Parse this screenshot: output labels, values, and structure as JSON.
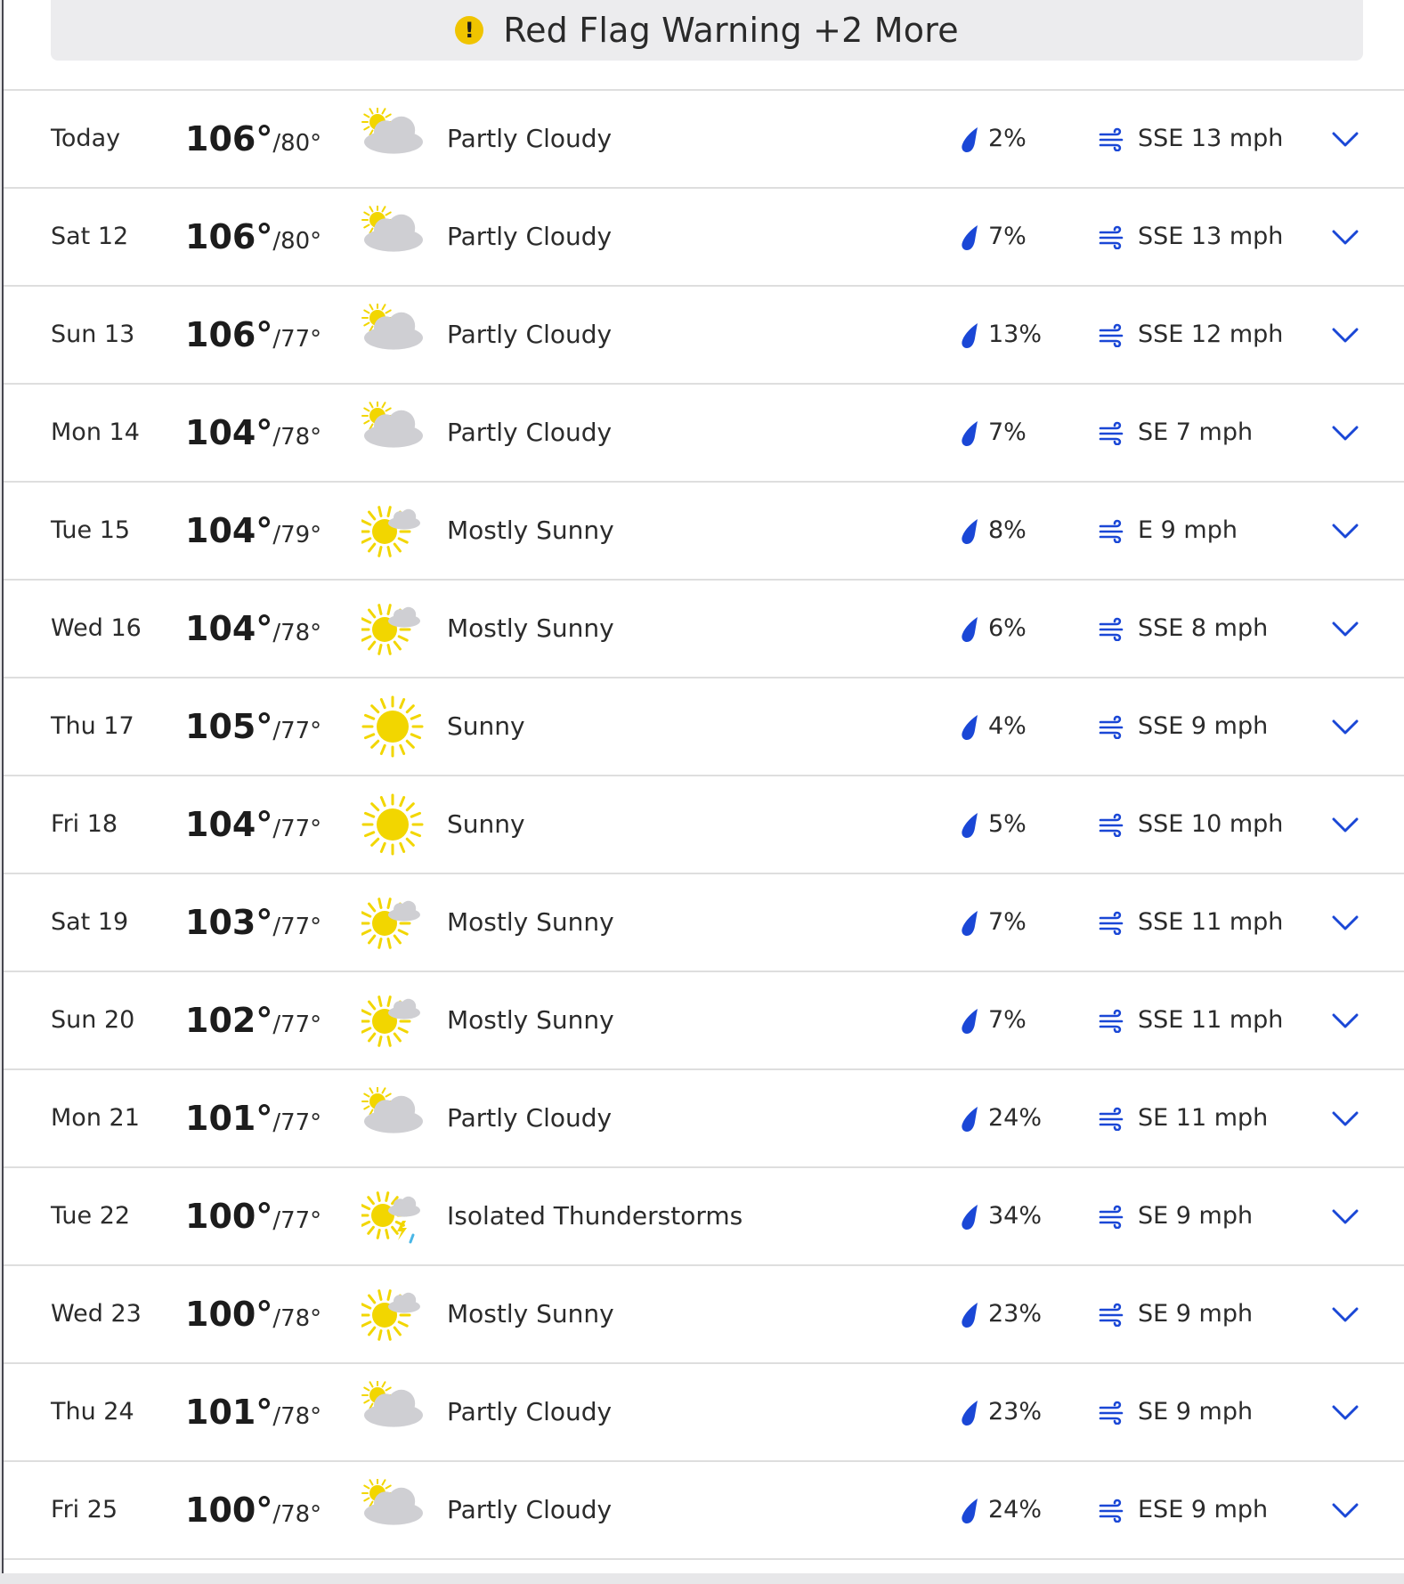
{
  "alert": {
    "icon": "exclamation-icon",
    "icon_glyph": "!",
    "text": "Red Flag Warning +2 More",
    "icon_color": "#f0c400"
  },
  "colors": {
    "accent_blue": "#1a47d6",
    "sun_yellow": "#f2d600",
    "cloud_gray": "#cfcfd3"
  },
  "forecast": [
    {
      "day": "Today",
      "high": "106°",
      "low": "/80°",
      "icon": "partly-cloudy-icon",
      "condition": "Partly Cloudy",
      "precip": "2%",
      "wind": "SSE 13 mph"
    },
    {
      "day": "Sat 12",
      "high": "106°",
      "low": "/80°",
      "icon": "partly-cloudy-icon",
      "condition": "Partly Cloudy",
      "precip": "7%",
      "wind": "SSE 13 mph"
    },
    {
      "day": "Sun 13",
      "high": "106°",
      "low": "/77°",
      "icon": "partly-cloudy-icon",
      "condition": "Partly Cloudy",
      "precip": "13%",
      "wind": "SSE 12 mph"
    },
    {
      "day": "Mon 14",
      "high": "104°",
      "low": "/78°",
      "icon": "partly-cloudy-icon",
      "condition": "Partly Cloudy",
      "precip": "7%",
      "wind": "SE 7 mph"
    },
    {
      "day": "Tue 15",
      "high": "104°",
      "low": "/79°",
      "icon": "mostly-sunny-icon",
      "condition": "Mostly Sunny",
      "precip": "8%",
      "wind": "E 9 mph"
    },
    {
      "day": "Wed 16",
      "high": "104°",
      "low": "/78°",
      "icon": "mostly-sunny-icon",
      "condition": "Mostly Sunny",
      "precip": "6%",
      "wind": "SSE 8 mph"
    },
    {
      "day": "Thu 17",
      "high": "105°",
      "low": "/77°",
      "icon": "sunny-icon",
      "condition": "Sunny",
      "precip": "4%",
      "wind": "SSE 9 mph"
    },
    {
      "day": "Fri 18",
      "high": "104°",
      "low": "/77°",
      "icon": "sunny-icon",
      "condition": "Sunny",
      "precip": "5%",
      "wind": "SSE 10 mph"
    },
    {
      "day": "Sat 19",
      "high": "103°",
      "low": "/77°",
      "icon": "mostly-sunny-icon",
      "condition": "Mostly Sunny",
      "precip": "7%",
      "wind": "SSE 11 mph"
    },
    {
      "day": "Sun 20",
      "high": "102°",
      "low": "/77°",
      "icon": "mostly-sunny-icon",
      "condition": "Mostly Sunny",
      "precip": "7%",
      "wind": "SSE 11 mph"
    },
    {
      "day": "Mon 21",
      "high": "101°",
      "low": "/77°",
      "icon": "partly-cloudy-icon",
      "condition": "Partly Cloudy",
      "precip": "24%",
      "wind": "SE 11 mph"
    },
    {
      "day": "Tue 22",
      "high": "100°",
      "low": "/77°",
      "icon": "isolated-thunderstorms-icon",
      "condition": "Isolated Thunderstorms",
      "precip": "34%",
      "wind": "SE 9 mph"
    },
    {
      "day": "Wed 23",
      "high": "100°",
      "low": "/78°",
      "icon": "mostly-sunny-icon",
      "condition": "Mostly Sunny",
      "precip": "23%",
      "wind": "SE 9 mph"
    },
    {
      "day": "Thu 24",
      "high": "101°",
      "low": "/78°",
      "icon": "partly-cloudy-icon",
      "condition": "Partly Cloudy",
      "precip": "23%",
      "wind": "SE 9 mph"
    },
    {
      "day": "Fri 25",
      "high": "100°",
      "low": "/78°",
      "icon": "partly-cloudy-icon",
      "condition": "Partly Cloudy",
      "precip": "24%",
      "wind": "ESE 9 mph"
    }
  ]
}
